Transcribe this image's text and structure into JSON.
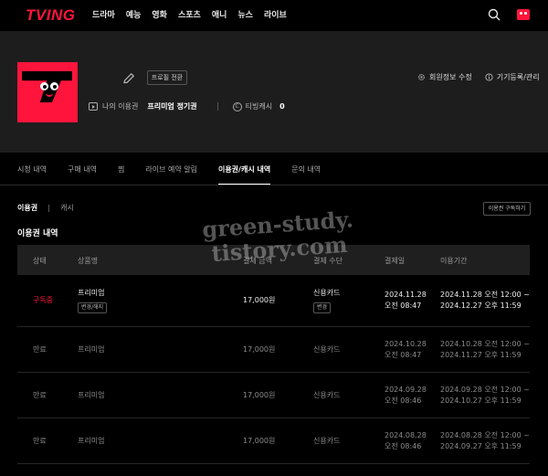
{
  "header": {
    "logo": "TVING",
    "nav": [
      "드라마",
      "예능",
      "영화",
      "스포츠",
      "애니",
      "뉴스",
      "라이브"
    ]
  },
  "profile": {
    "switch_label": "프로필 전환",
    "edit_member_label": "회원정보 수정",
    "device_label": "기기등록/관리",
    "my_pass_label": "나의 이용권",
    "my_pass_value": "프리미엄 정기권",
    "cash_label": "티빙캐시",
    "cash_value": "0"
  },
  "tabs": [
    "시청 내역",
    "구매 내역",
    "찜",
    "라이브 예약 알림",
    "이용권/캐시 내역",
    "문의 내역"
  ],
  "subtabs": {
    "active": "이용권",
    "inactive": "캐시"
  },
  "subscribe_label": "이용권 구독하기",
  "section_title": "이용권 내역",
  "table": {
    "headers": [
      "상태",
      "상품명",
      "결제 금액",
      "결제 수단",
      "결제일",
      "이용기간"
    ],
    "rows": [
      {
        "status": "구독중",
        "product": "프리미엄",
        "change_label": "변경/해지",
        "amount": "17,000원",
        "method": "신용카드",
        "method_btn": "변경",
        "date1": "2024.11.28",
        "date2": "오전 08:47",
        "period1": "2024.11.28 오전 12:00 ~",
        "period2": "2024.12.27 오후 11:59"
      },
      {
        "status": "만료",
        "product": "프리미엄",
        "amount": "17,000원",
        "method": "신용카드",
        "date1": "2024.10.28",
        "date2": "오전 08:47",
        "period1": "2024.10.28 오전 12:00 ~",
        "period2": "2024.11.27 오후 11:59"
      },
      {
        "status": "만료",
        "product": "프리미엄",
        "amount": "17,000원",
        "method": "신용카드",
        "date1": "2024.09.28",
        "date2": "오전 08:46",
        "period1": "2024.09.28 오전 12:00 ~",
        "period2": "2024.10.27 오후 11:59"
      },
      {
        "status": "만료",
        "product": "프리미엄",
        "amount": "17,000원",
        "method": "신용카드",
        "date1": "2024.08.28",
        "date2": "오전 08:46",
        "period1": "2024.08.28 오전 12:00 ~",
        "period2": "2024.09.27 오후 11:59"
      }
    ]
  },
  "watermark": {
    "line1": "green-study.",
    "line2": "tistory.com"
  },
  "colors": {
    "brand": "#ff153c",
    "band": "#1d1d1d",
    "header_row": "#1f1f1f"
  }
}
